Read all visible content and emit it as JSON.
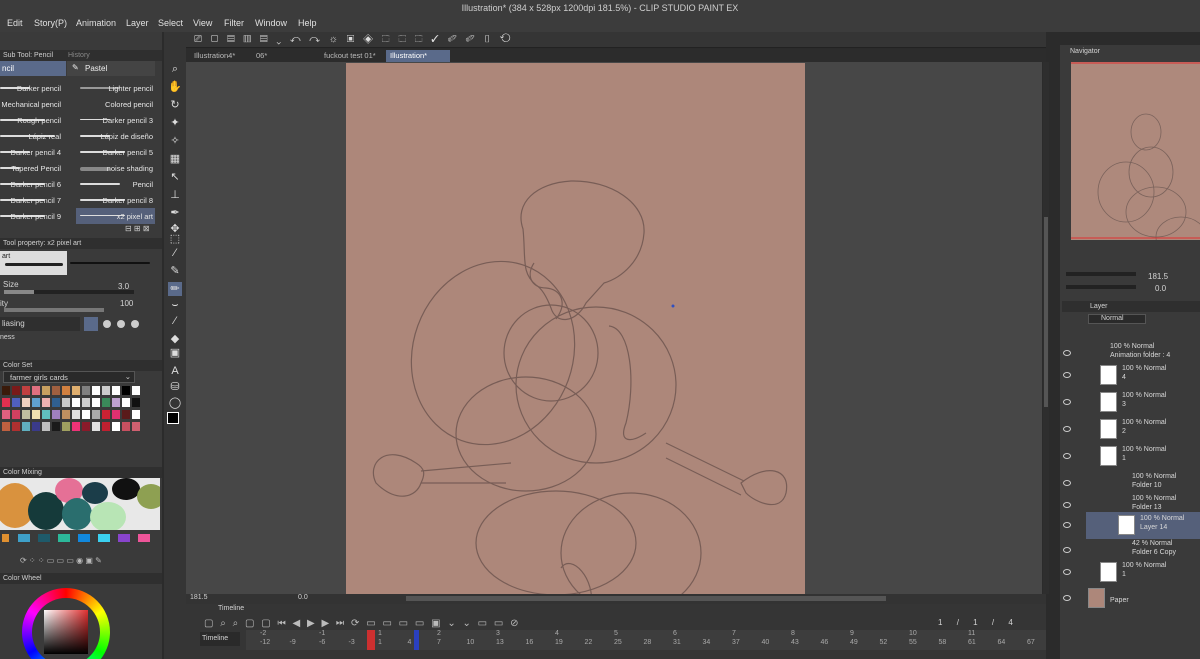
{
  "app": {
    "title": "Illustration* (384 x 528px 1200dpi 181.5%) - CLIP STUDIO PAINT EX"
  },
  "menu": [
    "Edit",
    "Story(P)",
    "Animation",
    "Layer",
    "Select",
    "View",
    "Filter",
    "Window",
    "Help"
  ],
  "subtool": {
    "tab_label": "Sub Tool: Pencil",
    "history_label": "History",
    "tabs": [
      "ncil",
      "Pastel"
    ],
    "brushes_left": [
      "Darker pencil",
      "Mechanical pencil",
      "Rough pencil",
      "Lápiz real",
      "Darker pencil 4",
      "Tapered Pencil",
      "Darker pencil 6",
      "Darker pencil 7",
      "Darker pencil 9"
    ],
    "brushes_right": [
      "Lighter pencil",
      "Colored pencil",
      "Darker pencil 3",
      "Lápiz de diseño",
      "Darker pencil 5",
      "noise shading",
      "Pencil",
      "Darker pencil 8",
      "x2 pixel art"
    ]
  },
  "toolprop": {
    "header": "Tool property: x2 pixel art",
    "preset": "art",
    "size_label": "Size",
    "size_value": "3.0",
    "opacity_label": "ity",
    "opacity_value": "100",
    "aa_label": "liasing",
    "extra_label": "ness"
  },
  "colorset": {
    "header": "Color Set",
    "selected": "farmer girls cards"
  },
  "colormixing": {
    "header": "Color Mixing"
  },
  "colorwheel": {
    "header": "Color Wheel"
  },
  "tabs": [
    "Illustration4*",
    "06*",
    "fuckout test 01*",
    "Illustration*"
  ],
  "status": {
    "zoom": "181.5",
    "angle": "0.0"
  },
  "timeline": {
    "header": "Timeline",
    "track": "Timeline",
    "frames_top": [
      "-2",
      "-1",
      "1",
      "2",
      "3",
      "4",
      "5",
      "6",
      "7",
      "8",
      "9",
      "10",
      "11"
    ],
    "frames_bottom": [
      "-12",
      "-9",
      "-6",
      "-3",
      "1",
      "4",
      "7",
      "10",
      "13",
      "16",
      "19",
      "22",
      "25",
      "28",
      "31",
      "34",
      "37",
      "40",
      "43",
      "46",
      "49",
      "52",
      "55",
      "58",
      "61",
      "64",
      "67"
    ],
    "counter": [
      "1",
      "/",
      "1",
      "/",
      "4"
    ]
  },
  "navigator": {
    "header": "Navigator",
    "zoom": "181.5",
    "angle": "0.0"
  },
  "layer": {
    "header": "Layer",
    "blend": "Normal",
    "rows": [
      {
        "pct": "100 % Normal",
        "name": "Animation folder : 4"
      },
      {
        "pct": "100 % Normal",
        "name": "4"
      },
      {
        "pct": "100 % Normal",
        "name": "3"
      },
      {
        "pct": "100 % Normal",
        "name": "2"
      },
      {
        "pct": "100 % Normal",
        "name": "1"
      },
      {
        "pct": "100 % Normal",
        "name": "Folder 10"
      },
      {
        "pct": "100 % Normal",
        "name": "Folder 13"
      },
      {
        "pct": "100 % Normal",
        "name": "Layer 14"
      },
      {
        "pct": "42 % Normal",
        "name": "Folder 6 Copy"
      },
      {
        "pct": "100 % Normal",
        "name": "1"
      },
      {
        "pct": "",
        "name": "Paper"
      }
    ]
  },
  "colors": {
    "paper": "#ad877a",
    "selected_tab": "#5a6a8a",
    "selected_layer": "#55607a",
    "accent_red": "#e03030"
  }
}
